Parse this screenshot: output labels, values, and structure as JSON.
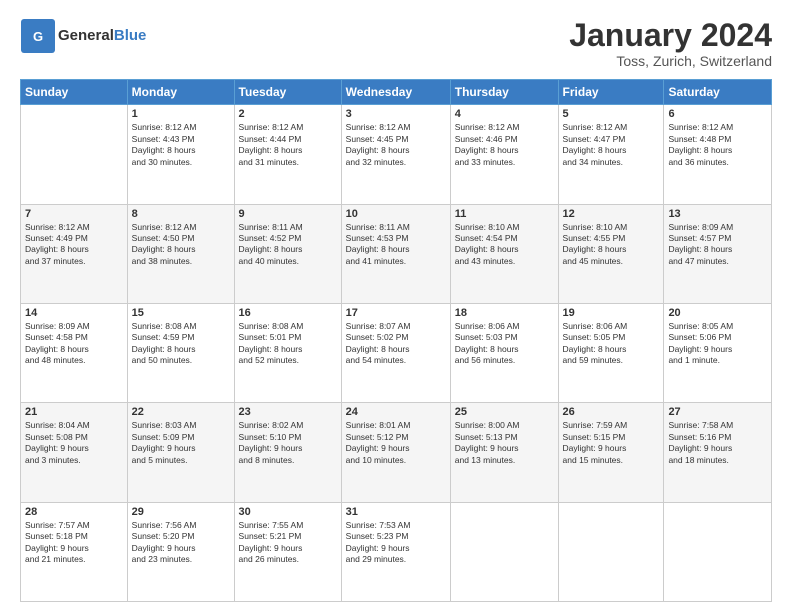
{
  "header": {
    "logo_general": "General",
    "logo_blue": "Blue",
    "title": "January 2024",
    "location": "Toss, Zurich, Switzerland"
  },
  "weekdays": [
    "Sunday",
    "Monday",
    "Tuesday",
    "Wednesday",
    "Thursday",
    "Friday",
    "Saturday"
  ],
  "weeks": [
    [
      {
        "day": "",
        "content": ""
      },
      {
        "day": "1",
        "content": "Sunrise: 8:12 AM\nSunset: 4:43 PM\nDaylight: 8 hours\nand 30 minutes."
      },
      {
        "day": "2",
        "content": "Sunrise: 8:12 AM\nSunset: 4:44 PM\nDaylight: 8 hours\nand 31 minutes."
      },
      {
        "day": "3",
        "content": "Sunrise: 8:12 AM\nSunset: 4:45 PM\nDaylight: 8 hours\nand 32 minutes."
      },
      {
        "day": "4",
        "content": "Sunrise: 8:12 AM\nSunset: 4:46 PM\nDaylight: 8 hours\nand 33 minutes."
      },
      {
        "day": "5",
        "content": "Sunrise: 8:12 AM\nSunset: 4:47 PM\nDaylight: 8 hours\nand 34 minutes."
      },
      {
        "day": "6",
        "content": "Sunrise: 8:12 AM\nSunset: 4:48 PM\nDaylight: 8 hours\nand 36 minutes."
      }
    ],
    [
      {
        "day": "7",
        "content": "Sunrise: 8:12 AM\nSunset: 4:49 PM\nDaylight: 8 hours\nand 37 minutes."
      },
      {
        "day": "8",
        "content": "Sunrise: 8:12 AM\nSunset: 4:50 PM\nDaylight: 8 hours\nand 38 minutes."
      },
      {
        "day": "9",
        "content": "Sunrise: 8:11 AM\nSunset: 4:52 PM\nDaylight: 8 hours\nand 40 minutes."
      },
      {
        "day": "10",
        "content": "Sunrise: 8:11 AM\nSunset: 4:53 PM\nDaylight: 8 hours\nand 41 minutes."
      },
      {
        "day": "11",
        "content": "Sunrise: 8:10 AM\nSunset: 4:54 PM\nDaylight: 8 hours\nand 43 minutes."
      },
      {
        "day": "12",
        "content": "Sunrise: 8:10 AM\nSunset: 4:55 PM\nDaylight: 8 hours\nand 45 minutes."
      },
      {
        "day": "13",
        "content": "Sunrise: 8:09 AM\nSunset: 4:57 PM\nDaylight: 8 hours\nand 47 minutes."
      }
    ],
    [
      {
        "day": "14",
        "content": "Sunrise: 8:09 AM\nSunset: 4:58 PM\nDaylight: 8 hours\nand 48 minutes."
      },
      {
        "day": "15",
        "content": "Sunrise: 8:08 AM\nSunset: 4:59 PM\nDaylight: 8 hours\nand 50 minutes."
      },
      {
        "day": "16",
        "content": "Sunrise: 8:08 AM\nSunset: 5:01 PM\nDaylight: 8 hours\nand 52 minutes."
      },
      {
        "day": "17",
        "content": "Sunrise: 8:07 AM\nSunset: 5:02 PM\nDaylight: 8 hours\nand 54 minutes."
      },
      {
        "day": "18",
        "content": "Sunrise: 8:06 AM\nSunset: 5:03 PM\nDaylight: 8 hours\nand 56 minutes."
      },
      {
        "day": "19",
        "content": "Sunrise: 8:06 AM\nSunset: 5:05 PM\nDaylight: 8 hours\nand 59 minutes."
      },
      {
        "day": "20",
        "content": "Sunrise: 8:05 AM\nSunset: 5:06 PM\nDaylight: 9 hours\nand 1 minute."
      }
    ],
    [
      {
        "day": "21",
        "content": "Sunrise: 8:04 AM\nSunset: 5:08 PM\nDaylight: 9 hours\nand 3 minutes."
      },
      {
        "day": "22",
        "content": "Sunrise: 8:03 AM\nSunset: 5:09 PM\nDaylight: 9 hours\nand 5 minutes."
      },
      {
        "day": "23",
        "content": "Sunrise: 8:02 AM\nSunset: 5:10 PM\nDaylight: 9 hours\nand 8 minutes."
      },
      {
        "day": "24",
        "content": "Sunrise: 8:01 AM\nSunset: 5:12 PM\nDaylight: 9 hours\nand 10 minutes."
      },
      {
        "day": "25",
        "content": "Sunrise: 8:00 AM\nSunset: 5:13 PM\nDaylight: 9 hours\nand 13 minutes."
      },
      {
        "day": "26",
        "content": "Sunrise: 7:59 AM\nSunset: 5:15 PM\nDaylight: 9 hours\nand 15 minutes."
      },
      {
        "day": "27",
        "content": "Sunrise: 7:58 AM\nSunset: 5:16 PM\nDaylight: 9 hours\nand 18 minutes."
      }
    ],
    [
      {
        "day": "28",
        "content": "Sunrise: 7:57 AM\nSunset: 5:18 PM\nDaylight: 9 hours\nand 21 minutes."
      },
      {
        "day": "29",
        "content": "Sunrise: 7:56 AM\nSunset: 5:20 PM\nDaylight: 9 hours\nand 23 minutes."
      },
      {
        "day": "30",
        "content": "Sunrise: 7:55 AM\nSunset: 5:21 PM\nDaylight: 9 hours\nand 26 minutes."
      },
      {
        "day": "31",
        "content": "Sunrise: 7:53 AM\nSunset: 5:23 PM\nDaylight: 9 hours\nand 29 minutes."
      },
      {
        "day": "",
        "content": ""
      },
      {
        "day": "",
        "content": ""
      },
      {
        "day": "",
        "content": ""
      }
    ]
  ]
}
